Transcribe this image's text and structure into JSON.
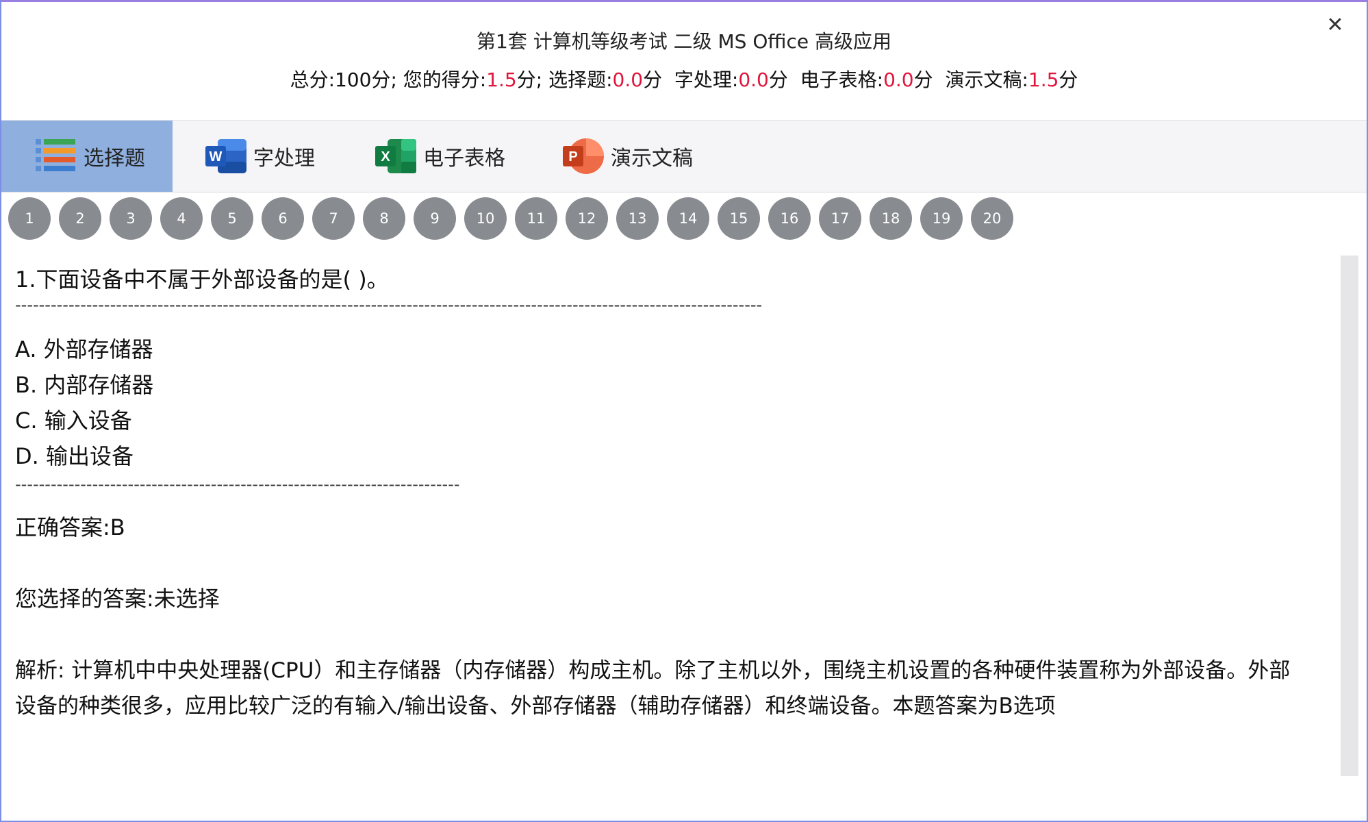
{
  "window": {
    "title": "第1套 计算机等级考试 二级 MS Office 高级应用",
    "close_label": "✕"
  },
  "scores": {
    "total_label": "总分:100分; ",
    "yours_label": "您的得分:",
    "yours_value": "1.5",
    "yours_unit": "分; ",
    "choice_label": "选择题:",
    "choice_value": "0.0",
    "choice_unit": "分  ",
    "word_label": "字处理:",
    "word_value": "0.0",
    "word_unit": "分  ",
    "excel_label": "电子表格:",
    "excel_value": "0.0",
    "excel_unit": "分  ",
    "ppt_label": "演示文稿:",
    "ppt_value": "1.5",
    "ppt_unit": "分"
  },
  "tabs": [
    {
      "label": "选择题",
      "icon": "list-icon"
    },
    {
      "label": "字处理",
      "icon": "word-icon"
    },
    {
      "label": "电子表格",
      "icon": "excel-icon"
    },
    {
      "label": "演示文稿",
      "icon": "powerpoint-icon"
    }
  ],
  "question_numbers": [
    "1",
    "2",
    "3",
    "4",
    "5",
    "6",
    "7",
    "8",
    "9",
    "10",
    "11",
    "12",
    "13",
    "14",
    "15",
    "16",
    "17",
    "18",
    "19",
    "20"
  ],
  "question": {
    "text": "1.下面设备中不属于外部设备的是( )。",
    "divider_long": "------------------------------------------------------------------------------------------------------------------------------",
    "divider_short": "---------------------------------------------------------------------------",
    "options": [
      "A. 外部存储器",
      "B. 内部存储器",
      "C. 输入设备",
      "D. 输出设备"
    ],
    "correct_answer": "正确答案:B",
    "your_answer": "您选择的答案:未选择",
    "explanation_line1": "解析: 计算机中中央处理器(CPU）和主存储器（内存储器）构成主机。除了主机以外，围绕主机设置的各种硬件装置称为外部设备。外部",
    "explanation_line2": "设备的种类很多，应用比较广泛的有输入/输出设备、外部存储器（辅助存储器）和终端设备。本题答案为B选项"
  },
  "colors": {
    "accent_red": "#e0163c",
    "active_tab": "#8fafdf",
    "number_circle": "#888b8f"
  }
}
